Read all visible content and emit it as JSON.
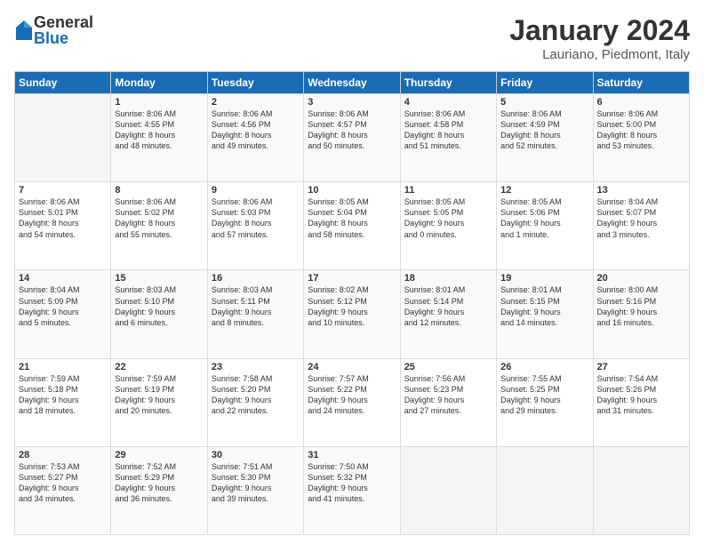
{
  "logo": {
    "general": "General",
    "blue": "Blue"
  },
  "title": "January 2024",
  "location": "Lauriano, Piedmont, Italy",
  "days_of_week": [
    "Sunday",
    "Monday",
    "Tuesday",
    "Wednesday",
    "Thursday",
    "Friday",
    "Saturday"
  ],
  "weeks": [
    [
      {
        "day": "",
        "info": ""
      },
      {
        "day": "1",
        "info": "Sunrise: 8:06 AM\nSunset: 4:55 PM\nDaylight: 8 hours\nand 48 minutes."
      },
      {
        "day": "2",
        "info": "Sunrise: 8:06 AM\nSunset: 4:56 PM\nDaylight: 8 hours\nand 49 minutes."
      },
      {
        "day": "3",
        "info": "Sunrise: 8:06 AM\nSunset: 4:57 PM\nDaylight: 8 hours\nand 50 minutes."
      },
      {
        "day": "4",
        "info": "Sunrise: 8:06 AM\nSunset: 4:58 PM\nDaylight: 8 hours\nand 51 minutes."
      },
      {
        "day": "5",
        "info": "Sunrise: 8:06 AM\nSunset: 4:59 PM\nDaylight: 8 hours\nand 52 minutes."
      },
      {
        "day": "6",
        "info": "Sunrise: 8:06 AM\nSunset: 5:00 PM\nDaylight: 8 hours\nand 53 minutes."
      }
    ],
    [
      {
        "day": "7",
        "info": "Sunrise: 8:06 AM\nSunset: 5:01 PM\nDaylight: 8 hours\nand 54 minutes."
      },
      {
        "day": "8",
        "info": "Sunrise: 8:06 AM\nSunset: 5:02 PM\nDaylight: 8 hours\nand 55 minutes."
      },
      {
        "day": "9",
        "info": "Sunrise: 8:06 AM\nSunset: 5:03 PM\nDaylight: 8 hours\nand 57 minutes."
      },
      {
        "day": "10",
        "info": "Sunrise: 8:05 AM\nSunset: 5:04 PM\nDaylight: 8 hours\nand 58 minutes."
      },
      {
        "day": "11",
        "info": "Sunrise: 8:05 AM\nSunset: 5:05 PM\nDaylight: 9 hours\nand 0 minutes."
      },
      {
        "day": "12",
        "info": "Sunrise: 8:05 AM\nSunset: 5:06 PM\nDaylight: 9 hours\nand 1 minute."
      },
      {
        "day": "13",
        "info": "Sunrise: 8:04 AM\nSunset: 5:07 PM\nDaylight: 9 hours\nand 3 minutes."
      }
    ],
    [
      {
        "day": "14",
        "info": "Sunrise: 8:04 AM\nSunset: 5:09 PM\nDaylight: 9 hours\nand 5 minutes."
      },
      {
        "day": "15",
        "info": "Sunrise: 8:03 AM\nSunset: 5:10 PM\nDaylight: 9 hours\nand 6 minutes."
      },
      {
        "day": "16",
        "info": "Sunrise: 8:03 AM\nSunset: 5:11 PM\nDaylight: 9 hours\nand 8 minutes."
      },
      {
        "day": "17",
        "info": "Sunrise: 8:02 AM\nSunset: 5:12 PM\nDaylight: 9 hours\nand 10 minutes."
      },
      {
        "day": "18",
        "info": "Sunrise: 8:01 AM\nSunset: 5:14 PM\nDaylight: 9 hours\nand 12 minutes."
      },
      {
        "day": "19",
        "info": "Sunrise: 8:01 AM\nSunset: 5:15 PM\nDaylight: 9 hours\nand 14 minutes."
      },
      {
        "day": "20",
        "info": "Sunrise: 8:00 AM\nSunset: 5:16 PM\nDaylight: 9 hours\nand 16 minutes."
      }
    ],
    [
      {
        "day": "21",
        "info": "Sunrise: 7:59 AM\nSunset: 5:18 PM\nDaylight: 9 hours\nand 18 minutes."
      },
      {
        "day": "22",
        "info": "Sunrise: 7:59 AM\nSunset: 5:19 PM\nDaylight: 9 hours\nand 20 minutes."
      },
      {
        "day": "23",
        "info": "Sunrise: 7:58 AM\nSunset: 5:20 PM\nDaylight: 9 hours\nand 22 minutes."
      },
      {
        "day": "24",
        "info": "Sunrise: 7:57 AM\nSunset: 5:22 PM\nDaylight: 9 hours\nand 24 minutes."
      },
      {
        "day": "25",
        "info": "Sunrise: 7:56 AM\nSunset: 5:23 PM\nDaylight: 9 hours\nand 27 minutes."
      },
      {
        "day": "26",
        "info": "Sunrise: 7:55 AM\nSunset: 5:25 PM\nDaylight: 9 hours\nand 29 minutes."
      },
      {
        "day": "27",
        "info": "Sunrise: 7:54 AM\nSunset: 5:26 PM\nDaylight: 9 hours\nand 31 minutes."
      }
    ],
    [
      {
        "day": "28",
        "info": "Sunrise: 7:53 AM\nSunset: 5:27 PM\nDaylight: 9 hours\nand 34 minutes."
      },
      {
        "day": "29",
        "info": "Sunrise: 7:52 AM\nSunset: 5:29 PM\nDaylight: 9 hours\nand 36 minutes."
      },
      {
        "day": "30",
        "info": "Sunrise: 7:51 AM\nSunset: 5:30 PM\nDaylight: 9 hours\nand 39 minutes."
      },
      {
        "day": "31",
        "info": "Sunrise: 7:50 AM\nSunset: 5:32 PM\nDaylight: 9 hours\nand 41 minutes."
      },
      {
        "day": "",
        "info": ""
      },
      {
        "day": "",
        "info": ""
      },
      {
        "day": "",
        "info": ""
      }
    ]
  ]
}
